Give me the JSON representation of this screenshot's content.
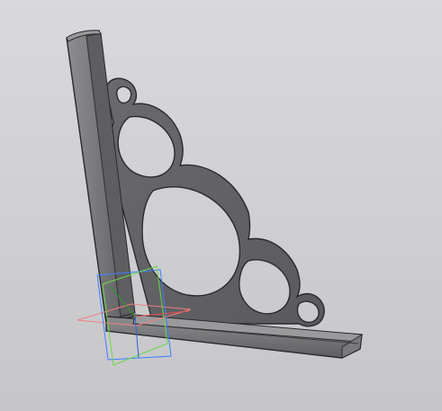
{
  "viewport": {
    "background_top": "#d9d9dc",
    "background_bottom": "#c6c6c9"
  },
  "model": {
    "part": "corner-shelf-bracket",
    "shade_light": "#8a8a8c",
    "shade_mid": "#6f6f72",
    "shade_dark": "#545456",
    "edge_color": "#2b2b2d",
    "cutout_color": "#cfcfd2"
  },
  "datum": {
    "plane_xy_color": "#f08080",
    "plane_zy_color": "#3f7fff",
    "plane_zx_color": "#6ad84a"
  }
}
